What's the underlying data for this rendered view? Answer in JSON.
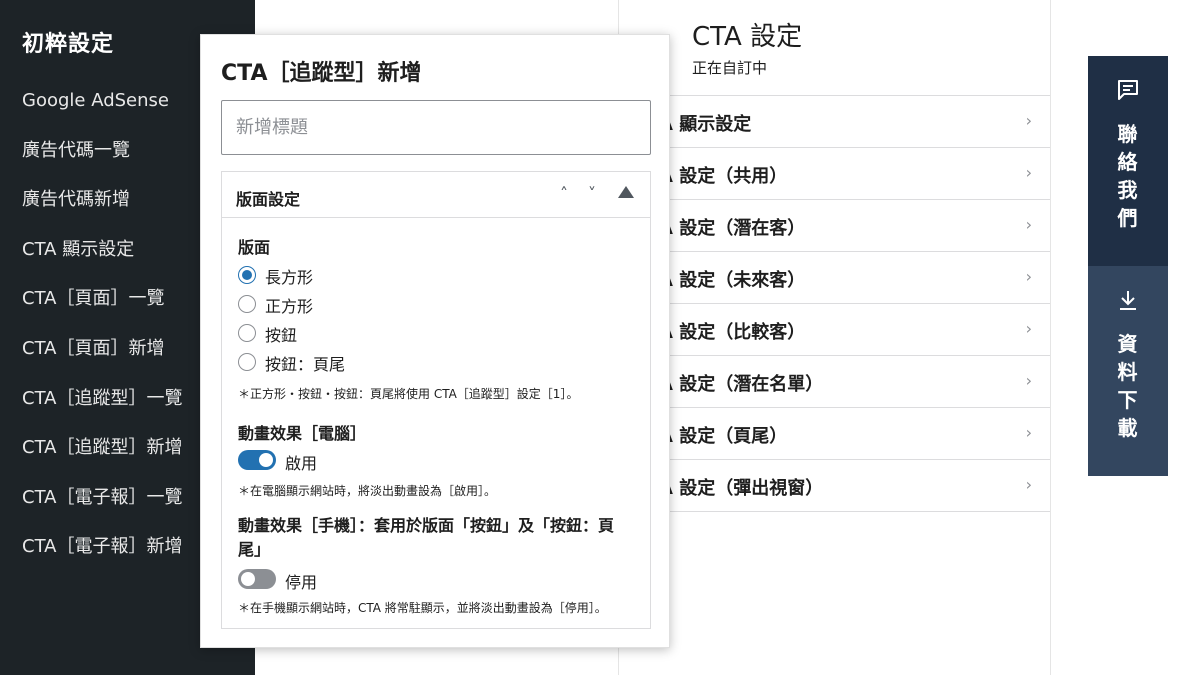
{
  "sidebar": {
    "title": "初粹設定",
    "items": [
      {
        "label": "Google AdSense"
      },
      {
        "label": "廣告代碼一覽"
      },
      {
        "label": "廣告代碼新增"
      },
      {
        "label": "CTA 顯示設定"
      },
      {
        "label": "CTA［頁面］一覽"
      },
      {
        "label": "CTA［頁面］新增"
      },
      {
        "label": "CTA［追蹤型］一覽"
      },
      {
        "label": "CTA［追蹤型］新增"
      },
      {
        "label": "CTA［電子報］一覽"
      },
      {
        "label": "CTA［電子報］新增"
      }
    ]
  },
  "cta_panel": {
    "title": "CTA 設定",
    "subtitle": "正在自訂中",
    "items": [
      {
        "label": "A 顯示設定"
      },
      {
        "label": "A 設定（共用）"
      },
      {
        "label": "A 設定（潛在客）"
      },
      {
        "label": "A 設定（未來客）"
      },
      {
        "label": "A 設定（比較客）"
      },
      {
        "label": "A 設定（潛在名單）"
      },
      {
        "label": "A 設定（頁尾）"
      },
      {
        "label": "A 設定（彈出視窗）"
      }
    ],
    "chevron": "›"
  },
  "floating": {
    "contact_icon": "chat-icon",
    "contact_chars": [
      "聯",
      "絡",
      "我",
      "們"
    ],
    "download_icon": "download-icon",
    "download_chars": [
      "資",
      "料",
      "下",
      "載"
    ]
  },
  "modal": {
    "title": "CTA［追蹤型］新增",
    "title_placeholder": "新增標題",
    "box": {
      "header": "版面設定",
      "up_glyph": "˄",
      "down_glyph": "˅",
      "layout_label": "版面",
      "layout_options": [
        {
          "label": "長方形",
          "checked": true
        },
        {
          "label": "正方形",
          "checked": false
        },
        {
          "label": "按鈕",
          "checked": false
        },
        {
          "label": "按鈕：頁尾",
          "checked": false
        }
      ],
      "layout_note": "＊正方形・按鈕・按鈕：頁尾將使用 CTA［追蹤型］設定［1］。",
      "anim_pc_label": "動畫效果［電腦］",
      "anim_pc_state": "啟用",
      "anim_pc_on": true,
      "anim_pc_note": "＊在電腦顯示網站時，將淡出動畫設為［啟用］。",
      "anim_mobile_label": "動畫效果［手機］：套用於版面「按鈕」及「按鈕：頁尾」",
      "anim_mobile_state": "停用",
      "anim_mobile_on": false,
      "anim_mobile_note": "＊在手機顯示網站時，CTA 將常駐顯示，並將淡出動畫設為［停用］。"
    }
  },
  "colors": {
    "sidebar_bg": "#1d2327",
    "accent": "#2271b1",
    "contact_bg": "#1f2f45",
    "download_bg": "#33465f"
  }
}
